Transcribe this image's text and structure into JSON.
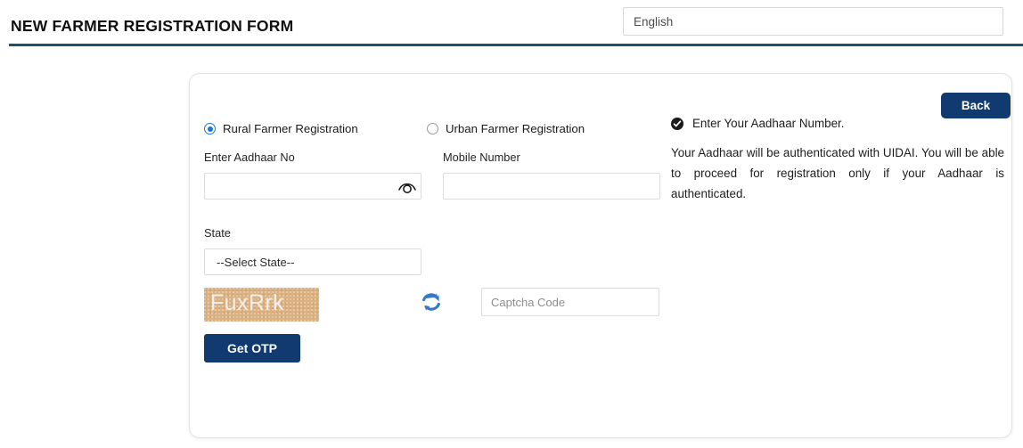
{
  "header": {
    "title": "NEW FARMER REGISTRATION FORM",
    "language_value": "English",
    "language_placeholder": "English",
    "divider_color": "#1f5070"
  },
  "card": {
    "back_label": "Back",
    "registration_type": {
      "selected": "rural",
      "options": [
        {
          "id": "rural",
          "label": "Rural Farmer Registration",
          "checked": true
        },
        {
          "id": "urban",
          "label": "Urban Farmer Registration",
          "checked": false
        }
      ]
    },
    "fields": {
      "aadhaar": {
        "label": "Enter Aadhaar No",
        "value": "",
        "placeholder": ""
      },
      "mobile": {
        "label": "Mobile Number",
        "value": "",
        "placeholder": ""
      },
      "state": {
        "label": "State",
        "value": "--Select State--",
        "options": [
          "--Select State--"
        ]
      },
      "captcha": {
        "value": "",
        "placeholder": "Captcha Code"
      }
    },
    "captcha": {
      "code_text": "FuxRrk",
      "background_color": "#dbb181",
      "text_color": "#f4f4f4",
      "refresh_icon": "refresh-icon"
    },
    "get_otp_label": "Get OTP",
    "icons": {
      "eye": "eye-icon",
      "check": "check-circle-icon"
    }
  },
  "info_panel": {
    "heading": "Enter Your Aadhaar Number.",
    "paragraph": "Your Aadhaar will be authenticated with UIDAI. You will be able to proceed for registration only if your Aadhaar is authenticated."
  },
  "colors": {
    "primary_button": "#103a70",
    "radio_accent": "#1878d2",
    "refresh_icon": "#3579c9",
    "border": "#dcdcdc"
  }
}
